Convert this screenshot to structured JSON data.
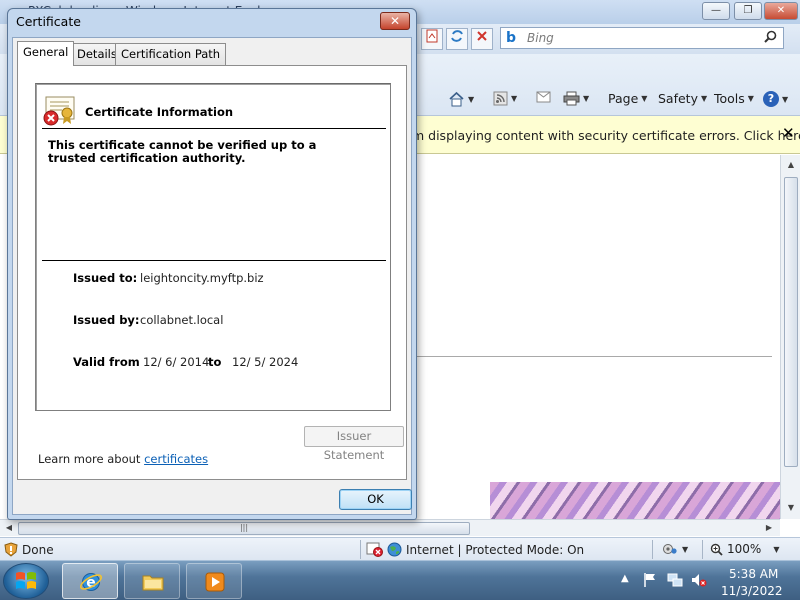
{
  "browser": {
    "window_title": "PXCal: landing - Windows Internet Explorer",
    "window_buttons": {
      "minimize": "—",
      "maximize": "❐",
      "close": "✕"
    },
    "search": {
      "engine_icon": "bing-icon",
      "placeholder": "Bing",
      "go_icon": "search-icon"
    },
    "command_bar": {
      "items": [
        {
          "label": "Page",
          "icon": "page-menu"
        },
        {
          "label": "Safety",
          "icon": "safety-menu"
        },
        {
          "label": "Tools",
          "icon": "tools-menu"
        }
      ],
      "help_label": "?"
    },
    "infobar": {
      "text": "m displaying content with security certificate errors. Click here for",
      "close_label": "✕"
    },
    "status": {
      "text": "Done",
      "zone": "Internet | Protected Mode: On",
      "zoom": "100%"
    },
    "scroll_grip": "|||"
  },
  "dialog": {
    "title": "Certificate",
    "close_label": "✕",
    "tabs": [
      {
        "label": "General",
        "selected": true
      },
      {
        "label": "Details",
        "selected": false
      },
      {
        "label": "Certification Path",
        "selected": false
      }
    ],
    "heading": "Certificate Information",
    "warning": "This certificate cannot be verified up to a trusted certification authority.",
    "issued_to_label": "Issued to:",
    "issued_to_value": "leightoncity.myftp.biz",
    "issued_by_label": "Issued by:",
    "issued_by_value": "collabnet.local",
    "valid_from_label": "Valid from",
    "valid_from_value": "12/ 6/ 2014",
    "valid_to_label": "to",
    "valid_to_value": "12/ 5/ 2024",
    "issuer_statement_label": "Issuer Statement",
    "learn_more_prefix": "Learn more about",
    "learn_more_link": "certificates",
    "ok_label": "OK"
  },
  "taskbar": {
    "time": "5:38 AM",
    "date": "11/3/2022"
  },
  "colors": {
    "accent_blue": "#0b60b6",
    "infobar_bg": "#fefed2",
    "close_red": "#c4432c"
  }
}
